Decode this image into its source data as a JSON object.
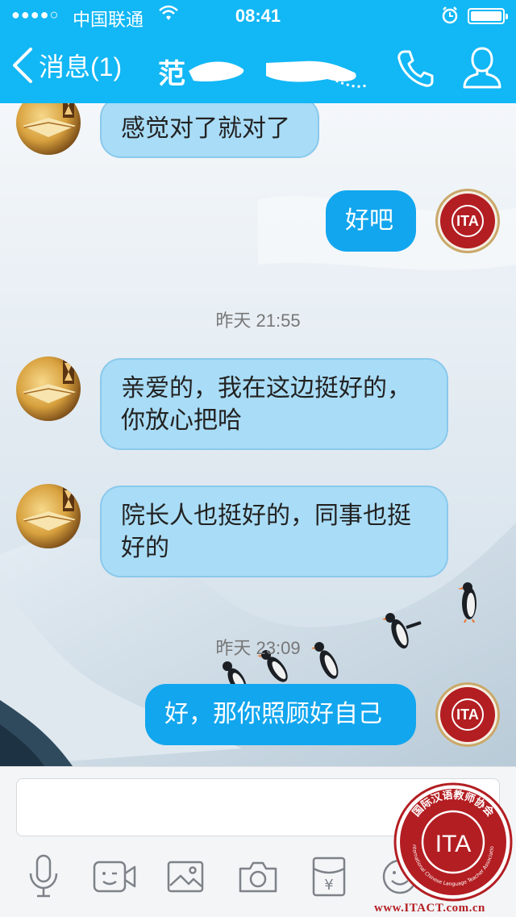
{
  "status_bar": {
    "signal_dots": "●●●●○",
    "carrier": "中国联通",
    "time": "08:41",
    "battery_level": 1.0,
    "icons": [
      "wifi-icon",
      "alarm-icon",
      "battery-icon"
    ]
  },
  "nav": {
    "back_label": "消息(1)",
    "contact_name_visible": "范",
    "icons": [
      "chevron-left-icon",
      "phone-icon",
      "profile-icon"
    ]
  },
  "messages": [
    {
      "direction": "in",
      "avatar": "book",
      "text": "感觉对了就对了"
    },
    {
      "direction": "out",
      "avatar": "ITA",
      "text": "好吧"
    },
    {
      "type": "timestamp",
      "text": "昨天 21:55"
    },
    {
      "direction": "in",
      "avatar": "book",
      "lines": [
        "亲爱的，我在这边挺好的，",
        "你放心把哈"
      ]
    },
    {
      "direction": "in",
      "avatar": "book",
      "lines": [
        "院长人也挺好的，同事也挺",
        "好的"
      ]
    },
    {
      "type": "timestamp",
      "text": "昨天 23:09"
    },
    {
      "direction": "out",
      "avatar": "ITA",
      "text": "好，那你照顾好自己"
    }
  ],
  "avatar_ita_text": "ITA",
  "input": {
    "value": "",
    "placeholder": ""
  },
  "toolbar": {
    "icons": [
      "microphone-icon",
      "video-call-icon",
      "image-icon",
      "camera-icon",
      "red-packet-icon",
      "emoji-icon"
    ],
    "red_packet_glyph": "¥"
  },
  "watermark": {
    "logo_text": "ITA",
    "arc_text_cn": "国际汉语教师协会",
    "arc_text_en": "International Chinese Language Teacher Association",
    "url": "www.ITACT.com.cn"
  },
  "colors": {
    "brand_blue": "#12b7f5",
    "incoming_bubble": "#a9dcf6",
    "outgoing_bubble": "#12a6ee",
    "ita_red": "#b31e22"
  }
}
